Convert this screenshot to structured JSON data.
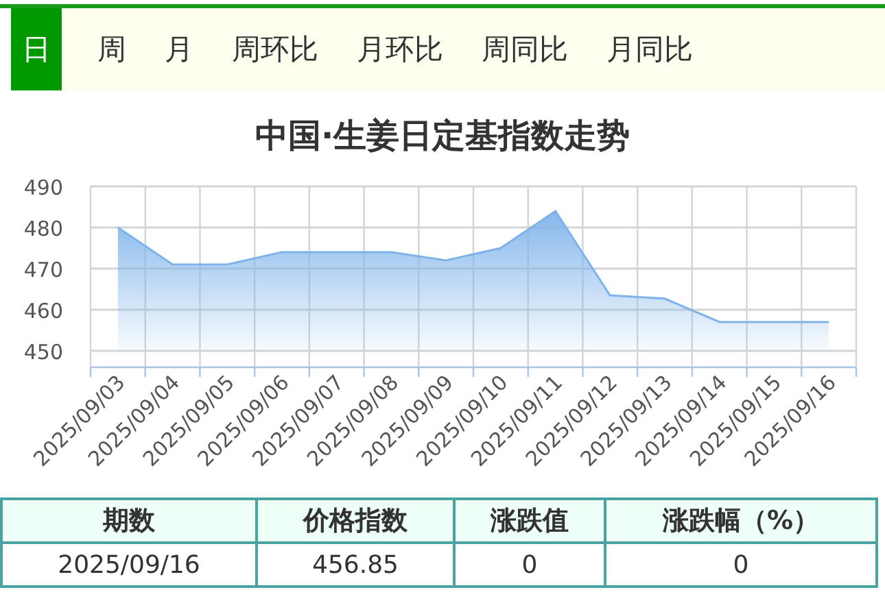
{
  "tabs": [
    {
      "label": "日",
      "selected": true
    },
    {
      "label": "周",
      "selected": false
    },
    {
      "label": "月",
      "selected": false
    },
    {
      "label": "周环比",
      "selected": false
    },
    {
      "label": "月环比",
      "selected": false
    },
    {
      "label": "周同比",
      "selected": false
    },
    {
      "label": "月同比",
      "selected": false
    }
  ],
  "chart": {
    "title": "中国·生姜日定基指数走势",
    "chart_data": {
      "type": "area",
      "categories": [
        "2025/09/03",
        "2025/09/04",
        "2025/09/05",
        "2025/09/06",
        "2025/09/07",
        "2025/09/08",
        "2025/09/09",
        "2025/09/10",
        "2025/09/11",
        "2025/09/12",
        "2025/09/13",
        "2025/09/14",
        "2025/09/15",
        "2025/09/16"
      ],
      "series": [
        {
          "color": "#7eb3ea",
          "values": [
            480,
            471,
            471,
            474,
            474,
            474,
            472,
            475,
            484,
            463.5,
            462.7,
            457,
            457,
            457
          ]
        }
      ],
      "grid": true,
      "ylim": [
        446,
        490
      ],
      "yticks": [
        450,
        460,
        470,
        480,
        490
      ]
    }
  },
  "table": {
    "columns": [
      "期数",
      "价格指数",
      "涨跌值",
      "涨跌幅（%）"
    ],
    "rows": [
      [
        "2025/09/16",
        "456.85",
        "0",
        "0"
      ]
    ]
  }
}
